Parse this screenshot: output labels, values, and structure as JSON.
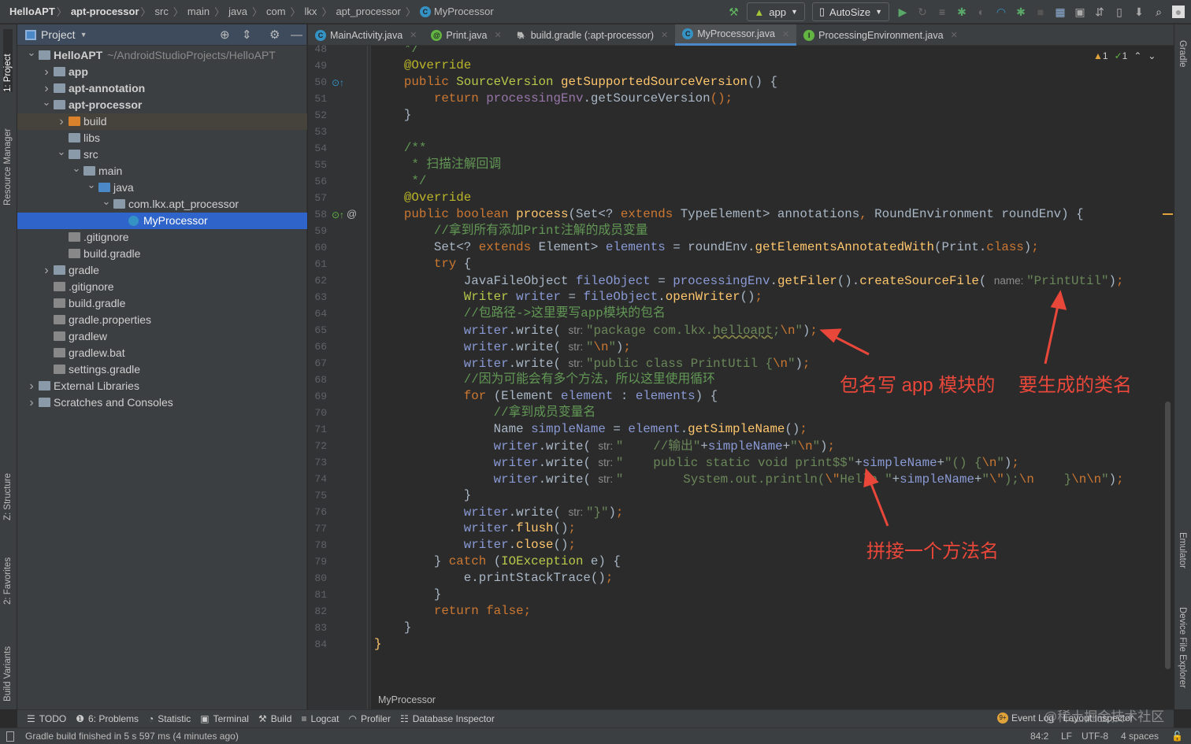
{
  "breadcrumb": [
    "HelloAPT",
    "apt-processor",
    "src",
    "main",
    "java",
    "com",
    "lkx",
    "apt_processor",
    "MyProcessor"
  ],
  "toolbar": {
    "run_config": "app",
    "device": "AutoSize"
  },
  "left_tabs": [
    "1: Project",
    "Resource Manager",
    "Z: Structure",
    "2: Favorites",
    "Build Variants"
  ],
  "right_tabs": [
    "Gradle",
    "Emulator",
    "Device File Explorer"
  ],
  "sidebar": {
    "title": "Project",
    "tree": [
      {
        "label": "HelloAPT",
        "sub": "~/AndroidStudioProjects/HelloAPT",
        "level": 0,
        "arrow": "open",
        "icon": "module",
        "bold": true
      },
      {
        "label": "app",
        "level": 1,
        "arrow": "closed",
        "icon": "module",
        "bold": true
      },
      {
        "label": "apt-annotation",
        "level": 1,
        "arrow": "closed",
        "icon": "module",
        "bold": true
      },
      {
        "label": "apt-processor",
        "level": 1,
        "arrow": "open",
        "icon": "module",
        "bold": true
      },
      {
        "label": "build",
        "level": 2,
        "arrow": "closed",
        "icon": "folder-orange",
        "state": "hl"
      },
      {
        "label": "libs",
        "level": 2,
        "icon": "folder"
      },
      {
        "label": "src",
        "level": 2,
        "arrow": "open",
        "icon": "folder"
      },
      {
        "label": "main",
        "level": 3,
        "arrow": "open",
        "icon": "folder"
      },
      {
        "label": "java",
        "level": 4,
        "arrow": "open",
        "icon": "folder-blue"
      },
      {
        "label": "com.lkx.apt_processor",
        "level": 5,
        "arrow": "open",
        "icon": "package"
      },
      {
        "label": "MyProcessor",
        "level": 6,
        "icon": "class",
        "state": "sel"
      },
      {
        "label": ".gitignore",
        "level": 2,
        "icon": "file"
      },
      {
        "label": "build.gradle",
        "level": 2,
        "icon": "gradle"
      },
      {
        "label": "gradle",
        "level": 1,
        "arrow": "closed",
        "icon": "folder"
      },
      {
        "label": ".gitignore",
        "level": 1,
        "icon": "file"
      },
      {
        "label": "build.gradle",
        "level": 1,
        "icon": "gradle"
      },
      {
        "label": "gradle.properties",
        "level": 1,
        "icon": "file"
      },
      {
        "label": "gradlew",
        "level": 1,
        "icon": "file"
      },
      {
        "label": "gradlew.bat",
        "level": 1,
        "icon": "file"
      },
      {
        "label": "settings.gradle",
        "level": 1,
        "icon": "gradle"
      },
      {
        "label": "External Libraries",
        "level": 0,
        "arrow": "closed",
        "icon": "libs"
      },
      {
        "label": "Scratches and Consoles",
        "level": 0,
        "arrow": "closed",
        "icon": "scratch"
      }
    ]
  },
  "tabs": [
    {
      "label": "MainActivity.java",
      "badge": "C",
      "color": "#3592c4"
    },
    {
      "label": "Print.java",
      "badge": "@",
      "color": "#62b543"
    },
    {
      "label": "build.gradle (:apt-processor)",
      "badge": "🐘",
      "color": ""
    },
    {
      "label": "MyProcessor.java",
      "badge": "C",
      "color": "#3592c4",
      "active": true
    },
    {
      "label": "ProcessingEnvironment.java",
      "badge": "I",
      "color": "#62b543"
    }
  ],
  "inspections": {
    "warnings": "1",
    "ok": "1"
  },
  "editor": {
    "first_line": 48,
    "lines": [
      [
        [
          "cmt",
          "    */"
        ]
      ],
      [
        [
          "ann",
          "    @Override"
        ]
      ],
      [
        [
          "kw",
          "    public "
        ],
        [
          "ty",
          "SourceVersion "
        ],
        [
          "fn",
          "getSupportedSourceVersion"
        ],
        [
          "",
          "() {"
        ]
      ],
      [
        [
          "kw",
          "        return "
        ],
        [
          "fld",
          "processingEnv"
        ],
        [
          "",
          ".getSourceVersion"
        ],
        [
          "kw",
          "();"
        ]
      ],
      [
        [
          "",
          "    }"
        ]
      ],
      [],
      [
        [
          "cmt",
          "    /**"
        ]
      ],
      [
        [
          "cmt",
          "     * 扫描注解回调"
        ]
      ],
      [
        [
          "cmt",
          "     */"
        ]
      ],
      [
        [
          "ann",
          "    @Override"
        ]
      ],
      [
        [
          "kw",
          "    public boolean "
        ],
        [
          "fn",
          "process"
        ],
        [
          "",
          "(Set<? "
        ],
        [
          "kw",
          "extends "
        ],
        [
          "",
          "TypeElement> annotations"
        ],
        [
          "kw",
          ", "
        ],
        [
          "",
          "RoundEnvironment roundEnv) {"
        ]
      ],
      [
        [
          "cmt",
          "        //拿到所有添加Print注解的成员变量"
        ]
      ],
      [
        [
          "",
          "        Set<? "
        ],
        [
          "kw",
          "extends "
        ],
        [
          "",
          "Element> "
        ],
        [
          "lv",
          "elements"
        ],
        [
          "",
          " = roundEnv."
        ],
        [
          "fn",
          "getElementsAnnotatedWith"
        ],
        [
          "",
          "(Print."
        ],
        [
          "kw",
          "class"
        ],
        [
          "",
          ")"
        ],
        [
          "kw",
          ";"
        ]
      ],
      [
        [
          "kw",
          "        try "
        ],
        [
          "",
          "{"
        ]
      ],
      [
        [
          "",
          "            JavaFileObject "
        ],
        [
          "lv",
          "fileObject"
        ],
        [
          "",
          " = "
        ],
        [
          "lv",
          "processingEnv"
        ],
        [
          "",
          "."
        ],
        [
          "fn",
          "getFiler"
        ],
        [
          "",
          "()."
        ],
        [
          "fn",
          "createSourceFile"
        ],
        [
          "",
          "( "
        ],
        [
          "hint",
          "name: "
        ],
        [
          "str",
          "\"PrintUtil\""
        ],
        [
          "",
          ")"
        ],
        [
          "kw",
          ";"
        ]
      ],
      [
        [
          "ty",
          "            Writer "
        ],
        [
          "lv",
          "writer"
        ],
        [
          "",
          " = "
        ],
        [
          "lv",
          "fileObject"
        ],
        [
          "",
          "."
        ],
        [
          "fn",
          "openWriter"
        ],
        [
          "",
          "()"
        ],
        [
          "kw",
          ";"
        ]
      ],
      [
        [
          "cmt",
          "            //包路径->这里要写app模块的包名"
        ]
      ],
      [
        [
          "lv",
          "            writer"
        ],
        [
          "",
          ".write( "
        ],
        [
          "hint",
          "str: "
        ],
        [
          "str",
          "\"package com.lkx.helloapt;"
        ],
        [
          "esc",
          "\\n"
        ],
        [
          "str",
          "\""
        ],
        [
          "",
          ")"
        ],
        [
          "kw",
          ";"
        ]
      ],
      [
        [
          "lv",
          "            writer"
        ],
        [
          "",
          ".write( "
        ],
        [
          "hint",
          "str: "
        ],
        [
          "str",
          "\""
        ],
        [
          "esc",
          "\\n"
        ],
        [
          "str",
          "\""
        ],
        [
          "",
          ")"
        ],
        [
          "kw",
          ";"
        ]
      ],
      [
        [
          "lv",
          "            writer"
        ],
        [
          "",
          ".write( "
        ],
        [
          "hint",
          "str: "
        ],
        [
          "str",
          "\"public class PrintUtil {"
        ],
        [
          "esc",
          "\\n"
        ],
        [
          "str",
          "\""
        ],
        [
          "",
          ")"
        ],
        [
          "kw",
          ";"
        ]
      ],
      [
        [
          "cmt",
          "            //因为可能会有多个方法，所以这里使用循环"
        ]
      ],
      [
        [
          "kw",
          "            for "
        ],
        [
          "",
          "(Element "
        ],
        [
          "lv",
          "element"
        ],
        [
          "",
          " : "
        ],
        [
          "lv",
          "elements"
        ],
        [
          "",
          ") {"
        ]
      ],
      [
        [
          "cmt",
          "                //拿到成员变量名"
        ]
      ],
      [
        [
          "",
          "                Name "
        ],
        [
          "lv",
          "simpleName"
        ],
        [
          "",
          " = "
        ],
        [
          "lv",
          "element"
        ],
        [
          "",
          "."
        ],
        [
          "fn",
          "getSimpleName"
        ],
        [
          "",
          "()"
        ],
        [
          "kw",
          ";"
        ]
      ],
      [
        [
          "lv",
          "                writer"
        ],
        [
          "",
          ".write( "
        ],
        [
          "hint",
          "str: "
        ],
        [
          "str",
          "\"    //输出\""
        ],
        [
          "",
          "+"
        ],
        [
          "lv",
          "simpleName"
        ],
        [
          "",
          "+"
        ],
        [
          "str",
          "\""
        ],
        [
          "esc",
          "\\n"
        ],
        [
          "str",
          "\""
        ],
        [
          "",
          ")"
        ],
        [
          "kw",
          ";"
        ]
      ],
      [
        [
          "lv",
          "                writer"
        ],
        [
          "",
          ".write( "
        ],
        [
          "hint",
          "str: "
        ],
        [
          "str",
          "\"    public static void print$$\""
        ],
        [
          "",
          "+"
        ],
        [
          "lv",
          "simpleName"
        ],
        [
          "",
          "+"
        ],
        [
          "str",
          "\"() {"
        ],
        [
          "esc",
          "\\n"
        ],
        [
          "str",
          "\""
        ],
        [
          "",
          ")"
        ],
        [
          "kw",
          ";"
        ]
      ],
      [
        [
          "lv",
          "                writer"
        ],
        [
          "",
          ".write( "
        ],
        [
          "hint",
          "str: "
        ],
        [
          "str",
          "\"        System.out.println("
        ],
        [
          "esc",
          "\\\""
        ],
        [
          "str",
          "Hello \""
        ],
        [
          "",
          "+"
        ],
        [
          "lv",
          "simpleName"
        ],
        [
          "",
          "+"
        ],
        [
          "str",
          "\""
        ],
        [
          "esc",
          "\\\""
        ],
        [
          "str",
          ");"
        ],
        [
          "esc",
          "\\n"
        ],
        [
          "str",
          "    }"
        ],
        [
          "esc",
          "\\n\\n"
        ],
        [
          "str",
          "\""
        ],
        [
          "",
          ")"
        ],
        [
          "kw",
          ";"
        ]
      ],
      [
        [
          "",
          "            }"
        ]
      ],
      [
        [
          "lv",
          "            writer"
        ],
        [
          "",
          ".write( "
        ],
        [
          "hint",
          "str: "
        ],
        [
          "str",
          "\"}\""
        ],
        [
          "",
          ")"
        ],
        [
          "kw",
          ";"
        ]
      ],
      [
        [
          "lv",
          "            writer"
        ],
        [
          "",
          "."
        ],
        [
          "fn",
          "flush"
        ],
        [
          "",
          "()"
        ],
        [
          "kw",
          ";"
        ]
      ],
      [
        [
          "lv",
          "            writer"
        ],
        [
          "",
          "."
        ],
        [
          "fn",
          "close"
        ],
        [
          "",
          "()"
        ],
        [
          "kw",
          ";"
        ]
      ],
      [
        [
          "",
          "        } "
        ],
        [
          "kw",
          "catch "
        ],
        [
          "",
          "("
        ],
        [
          "ty",
          "IOException"
        ],
        [
          "",
          " e) {"
        ]
      ],
      [
        [
          "",
          "            e.printStackTrace()"
        ],
        [
          "kw",
          ";"
        ]
      ],
      [
        [
          "",
          "        }"
        ]
      ],
      [
        [
          "kw",
          "        return false;"
        ]
      ],
      [
        [
          "",
          "    }"
        ]
      ],
      [
        [
          "fn",
          "}"
        ]
      ]
    ]
  },
  "editor_breadcrumb": "MyProcessor",
  "annotations": {
    "package_note": "包名写 app 模块的",
    "class_note": "要生成的类名",
    "method_note": "拼接一个方法名"
  },
  "bottom_tools": [
    "TODO",
    "6: Problems",
    "Statistic",
    "Terminal",
    "Build",
    "Logcat",
    "Profiler",
    "Database Inspector"
  ],
  "event_log": "Event Log",
  "layout_inspector": "Layout Inspector",
  "watermark": "@稀土掘金技术社区",
  "status": {
    "message": "Gradle build finished in 5 s 597 ms (4 minutes ago)",
    "position": "84:2",
    "line_sep": "LF",
    "encoding": "UTF-8",
    "indent": "4 spaces"
  },
  "colors": {
    "accent": "#2f65ca",
    "annotation": "#e8473a"
  }
}
